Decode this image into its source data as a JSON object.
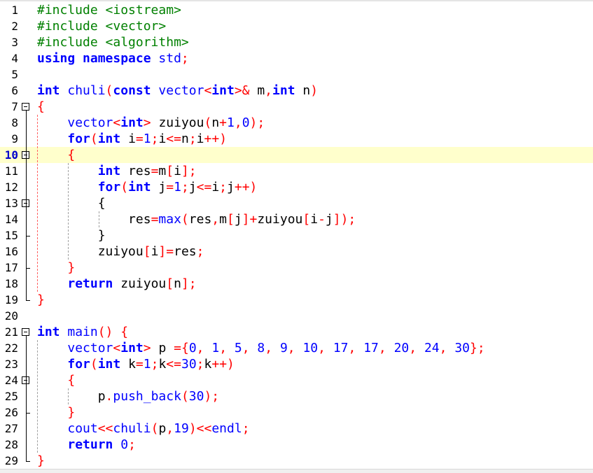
{
  "editor": {
    "current_line": 10,
    "lines": [
      {
        "n": "1",
        "t": [
          [
            "pp",
            "#include <iostream>"
          ]
        ]
      },
      {
        "n": "2",
        "t": [
          [
            "pp",
            "#include <vector>"
          ]
        ]
      },
      {
        "n": "3",
        "t": [
          [
            "pp",
            "#include <algorithm>"
          ]
        ]
      },
      {
        "n": "4",
        "t": [
          [
            "kw",
            "using namespace "
          ],
          [
            "ty",
            "std"
          ],
          [
            "sy",
            ";"
          ]
        ]
      },
      {
        "n": "5",
        "t": []
      },
      {
        "n": "6",
        "t": [
          [
            "kw",
            "int "
          ],
          [
            "ty",
            "chuli"
          ],
          [
            "sy",
            "("
          ],
          [
            "kw",
            "const "
          ],
          [
            "ty",
            "vector"
          ],
          [
            "sy",
            "<"
          ],
          [
            "kw",
            "int"
          ],
          [
            "sy",
            ">& "
          ],
          [
            "",
            "m"
          ],
          [
            "sy",
            ","
          ],
          [
            "kw",
            "int "
          ],
          [
            "",
            "n"
          ],
          [
            "sy",
            ")"
          ]
        ]
      },
      {
        "n": "7",
        "t": [
          [
            "sy",
            "{"
          ]
        ]
      },
      {
        "n": "8",
        "t": [
          [
            "",
            "    "
          ],
          [
            "ty",
            "vector"
          ],
          [
            "sy",
            "<"
          ],
          [
            "kw",
            "int"
          ],
          [
            "sy",
            "> "
          ],
          [
            "",
            "zuiyou"
          ],
          [
            "sy",
            "("
          ],
          [
            "",
            "n"
          ],
          [
            "sy",
            "+"
          ],
          [
            "nm",
            "1"
          ],
          [
            "sy",
            ","
          ],
          [
            "nm",
            "0"
          ],
          [
            "sy",
            ");"
          ]
        ]
      },
      {
        "n": "9",
        "t": [
          [
            "",
            "    "
          ],
          [
            "kw",
            "for"
          ],
          [
            "sy",
            "("
          ],
          [
            "kw",
            "int "
          ],
          [
            "",
            "i"
          ],
          [
            "sy",
            "="
          ],
          [
            "nm",
            "1"
          ],
          [
            "sy",
            ";"
          ],
          [
            "",
            "i"
          ],
          [
            "sy",
            "<="
          ],
          [
            "",
            "n"
          ],
          [
            "sy",
            ";"
          ],
          [
            "",
            "i"
          ],
          [
            "sy",
            "++)"
          ]
        ]
      },
      {
        "n": "10",
        "t": [
          [
            "",
            "    "
          ],
          [
            "sy",
            "{"
          ]
        ]
      },
      {
        "n": "11",
        "t": [
          [
            "",
            "        "
          ],
          [
            "kw",
            "int "
          ],
          [
            "",
            "res"
          ],
          [
            "sy",
            "="
          ],
          [
            "",
            "m"
          ],
          [
            "sy",
            "["
          ],
          [
            "",
            "i"
          ],
          [
            "sy",
            "];"
          ]
        ]
      },
      {
        "n": "12",
        "t": [
          [
            "",
            "        "
          ],
          [
            "kw",
            "for"
          ],
          [
            "sy",
            "("
          ],
          [
            "kw",
            "int "
          ],
          [
            "",
            "j"
          ],
          [
            "sy",
            "="
          ],
          [
            "nm",
            "1"
          ],
          [
            "sy",
            ";"
          ],
          [
            "",
            "j"
          ],
          [
            "sy",
            "<="
          ],
          [
            "",
            "i"
          ],
          [
            "sy",
            ";"
          ],
          [
            "",
            "j"
          ],
          [
            "sy",
            "++)"
          ]
        ]
      },
      {
        "n": "13",
        "t": [
          [
            "",
            "        "
          ],
          [
            "",
            "{"
          ]
        ]
      },
      {
        "n": "14",
        "t": [
          [
            "",
            "            "
          ],
          [
            "",
            "res"
          ],
          [
            "sy",
            "="
          ],
          [
            "ty",
            "max"
          ],
          [
            "sy",
            "("
          ],
          [
            "",
            "res"
          ],
          [
            "sy",
            ","
          ],
          [
            "",
            "m"
          ],
          [
            "sy",
            "["
          ],
          [
            "",
            "j"
          ],
          [
            "sy",
            "]+"
          ],
          [
            "",
            "zuiyou"
          ],
          [
            "sy",
            "["
          ],
          [
            "",
            "i"
          ],
          [
            "sy",
            "-"
          ],
          [
            "",
            "j"
          ],
          [
            "sy",
            "]);"
          ]
        ]
      },
      {
        "n": "15",
        "t": [
          [
            "",
            "        "
          ],
          [
            "",
            "}"
          ]
        ]
      },
      {
        "n": "16",
        "t": [
          [
            "",
            "        "
          ],
          [
            "",
            "zuiyou"
          ],
          [
            "sy",
            "["
          ],
          [
            "",
            "i"
          ],
          [
            "sy",
            "]="
          ],
          [
            "",
            "res"
          ],
          [
            "sy",
            ";"
          ]
        ]
      },
      {
        "n": "17",
        "t": [
          [
            "",
            "    "
          ],
          [
            "sy",
            "}"
          ]
        ]
      },
      {
        "n": "18",
        "t": [
          [
            "",
            "    "
          ],
          [
            "kw",
            "return "
          ],
          [
            "",
            "zuiyou"
          ],
          [
            "sy",
            "["
          ],
          [
            "",
            "n"
          ],
          [
            "sy",
            "];"
          ]
        ]
      },
      {
        "n": "19",
        "t": [
          [
            "sy",
            "}"
          ]
        ]
      },
      {
        "n": "20",
        "t": []
      },
      {
        "n": "21",
        "t": [
          [
            "kw",
            "int "
          ],
          [
            "ty",
            "main"
          ],
          [
            "sy",
            "() {"
          ]
        ]
      },
      {
        "n": "22",
        "t": [
          [
            "",
            "    "
          ],
          [
            "ty",
            "vector"
          ],
          [
            "sy",
            "<"
          ],
          [
            "kw",
            "int"
          ],
          [
            "sy",
            "> "
          ],
          [
            "",
            "p "
          ],
          [
            "sy",
            "={"
          ],
          [
            "nm",
            "0"
          ],
          [
            "sy",
            ", "
          ],
          [
            "nm",
            "1"
          ],
          [
            "sy",
            ", "
          ],
          [
            "nm",
            "5"
          ],
          [
            "sy",
            ", "
          ],
          [
            "nm",
            "8"
          ],
          [
            "sy",
            ", "
          ],
          [
            "nm",
            "9"
          ],
          [
            "sy",
            ", "
          ],
          [
            "nm",
            "10"
          ],
          [
            "sy",
            ", "
          ],
          [
            "nm",
            "17"
          ],
          [
            "sy",
            ", "
          ],
          [
            "nm",
            "17"
          ],
          [
            "sy",
            ", "
          ],
          [
            "nm",
            "20"
          ],
          [
            "sy",
            ", "
          ],
          [
            "nm",
            "24"
          ],
          [
            "sy",
            ", "
          ],
          [
            "nm",
            "30"
          ],
          [
            "sy",
            "};"
          ]
        ]
      },
      {
        "n": "23",
        "t": [
          [
            "",
            "    "
          ],
          [
            "kw",
            "for"
          ],
          [
            "sy",
            "("
          ],
          [
            "kw",
            "int "
          ],
          [
            "",
            "k"
          ],
          [
            "sy",
            "="
          ],
          [
            "nm",
            "1"
          ],
          [
            "sy",
            ";"
          ],
          [
            "",
            "k"
          ],
          [
            "sy",
            "<="
          ],
          [
            "nm",
            "30"
          ],
          [
            "sy",
            ";"
          ],
          [
            "",
            "k"
          ],
          [
            "sy",
            "++)"
          ]
        ]
      },
      {
        "n": "24",
        "t": [
          [
            "",
            "    "
          ],
          [
            "sy",
            "{"
          ]
        ]
      },
      {
        "n": "25",
        "t": [
          [
            "",
            "        "
          ],
          [
            "",
            "p"
          ],
          [
            "sy",
            "."
          ],
          [
            "ty",
            "push_back"
          ],
          [
            "sy",
            "("
          ],
          [
            "nm",
            "30"
          ],
          [
            "sy",
            ");"
          ]
        ]
      },
      {
        "n": "26",
        "t": [
          [
            "",
            "    "
          ],
          [
            "sy",
            "}"
          ]
        ]
      },
      {
        "n": "27",
        "t": [
          [
            "",
            "    "
          ],
          [
            "ty",
            "cout"
          ],
          [
            "sy",
            "<<"
          ],
          [
            "ty",
            "chuli"
          ],
          [
            "sy",
            "("
          ],
          [
            "",
            "p"
          ],
          [
            "sy",
            ","
          ],
          [
            "nm",
            "19"
          ],
          [
            "sy",
            ")<<"
          ],
          [
            "ty",
            "endl"
          ],
          [
            "sy",
            ";"
          ]
        ]
      },
      {
        "n": "28",
        "t": [
          [
            "",
            "    "
          ],
          [
            "kw",
            "return "
          ],
          [
            "nm",
            "0"
          ],
          [
            "sy",
            ";"
          ]
        ]
      },
      {
        "n": "29",
        "t": [
          [
            "sy",
            "}"
          ]
        ]
      }
    ]
  }
}
